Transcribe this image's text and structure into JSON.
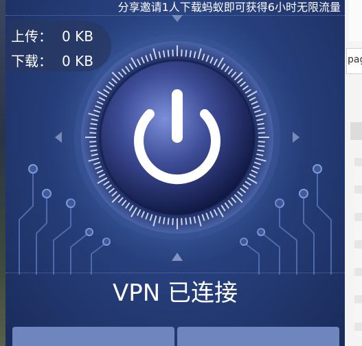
{
  "ticker": {
    "text": "分享邀请1人下载蚂蚁即可获得6小时无限流量"
  },
  "stats": {
    "upload_label": "上传：",
    "upload_value": "0 KB",
    "download_label": "下载：",
    "download_value": "0 KB"
  },
  "status": {
    "text": "VPN 已连接"
  },
  "background": {
    "right_window_text": "pag"
  },
  "colors": {
    "panel": "#27407d",
    "button": "#6e86bd",
    "text": "#ffffff"
  },
  "icons": [
    "power-icon"
  ]
}
